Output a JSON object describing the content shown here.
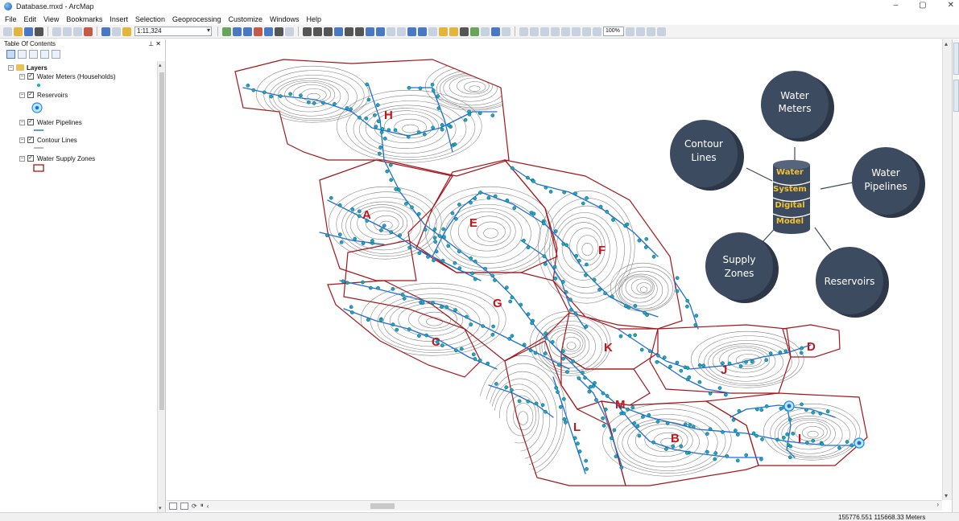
{
  "window": {
    "title": "Database.mxd - ArcMap",
    "controls": [
      "–",
      "▢",
      "✕"
    ]
  },
  "menu": [
    "File",
    "Edit",
    "View",
    "Bookmarks",
    "Insert",
    "Selection",
    "Geoprocessing",
    "Customize",
    "Windows",
    "Help"
  ],
  "toolbar": {
    "scale_value": "1:11,324",
    "zoom_value": "100%"
  },
  "toc": {
    "title": "Table Of Contents",
    "pin": "⊥ ✕",
    "root_label": "Layers",
    "layers": [
      {
        "label": "Water Meters (Households)",
        "checked": true
      },
      {
        "label": "Reservoirs",
        "checked": true
      },
      {
        "label": "Water Pipelines",
        "checked": true
      },
      {
        "label": "Contour Lines",
        "checked": true
      },
      {
        "label": "Water Supply Zones",
        "checked": true
      }
    ]
  },
  "map": {
    "zones": [
      "H",
      "A",
      "E",
      "F",
      "G",
      "C",
      "K",
      "J",
      "D",
      "M",
      "L",
      "B",
      "I"
    ],
    "colors": {
      "zone_outline": "#a4161a",
      "pipeline": "#1f6fd6",
      "meter": "#1aa7c9",
      "contour": "#8a8a8a",
      "bubble": "#3d4b60",
      "db_text": "#f2c230"
    }
  },
  "diagram": {
    "center": [
      "Water",
      "System",
      "Digital",
      "Model"
    ],
    "bubbles": {
      "water_meters": [
        "Water",
        "Meters"
      ],
      "contour_lines": [
        "Contour",
        "Lines"
      ],
      "water_pipelines": [
        "Water",
        "Pipelines"
      ],
      "supply_zones": [
        "Supply",
        "Zones"
      ],
      "reservoirs": [
        "Reservoirs"
      ]
    }
  },
  "status": {
    "coordinates": "155776.551  115668.33 Meters"
  }
}
